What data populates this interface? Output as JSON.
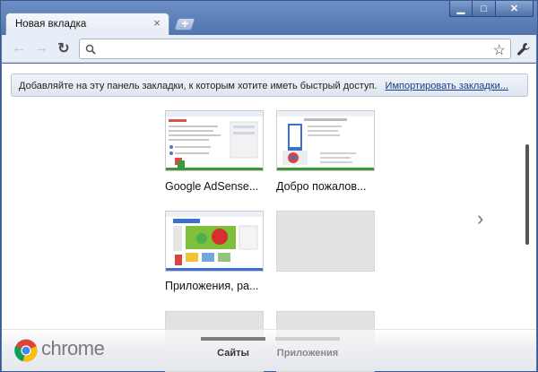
{
  "window": {
    "tab_title": "Новая вкладка",
    "new_tab_symbol": "+",
    "minimize_symbol": "▁",
    "maximize_symbol": "□",
    "close_symbol": "✕"
  },
  "toolbar": {
    "back_icon": "back-arrow-icon",
    "forward_icon": "forward-arrow-icon",
    "reload_icon": "reload-icon",
    "omnibox_value": "",
    "star_icon": "star-icon",
    "wrench_icon": "wrench-icon"
  },
  "bookmark_bar": {
    "message": "Добавляйте на эту панель закладки, к которым хотите иметь быстрый доступ.",
    "import_link": "Импортировать закладки..."
  },
  "thumbnails": [
    {
      "label": "Google AdSense...",
      "accent": "#3a9a3a",
      "state": "filled"
    },
    {
      "label": "Добро пожалов...",
      "accent": "#3a9a3a",
      "state": "filled"
    },
    {
      "label": "Приложения, ра...",
      "accent": "#3b6fd1",
      "state": "filled"
    },
    {
      "label": "",
      "accent": "",
      "state": "empty"
    },
    {
      "label": "",
      "accent": "",
      "state": "empty"
    },
    {
      "label": "",
      "accent": "",
      "state": "empty"
    }
  ],
  "footer": {
    "brand": "chrome",
    "tabs": [
      {
        "label": "Сайты",
        "active": true
      },
      {
        "label": "Приложения",
        "active": false
      }
    ]
  },
  "colors": {
    "frame": "#4f73ad",
    "thumb_green": "#3a9a3a",
    "thumb_blue": "#3b6fd1"
  }
}
